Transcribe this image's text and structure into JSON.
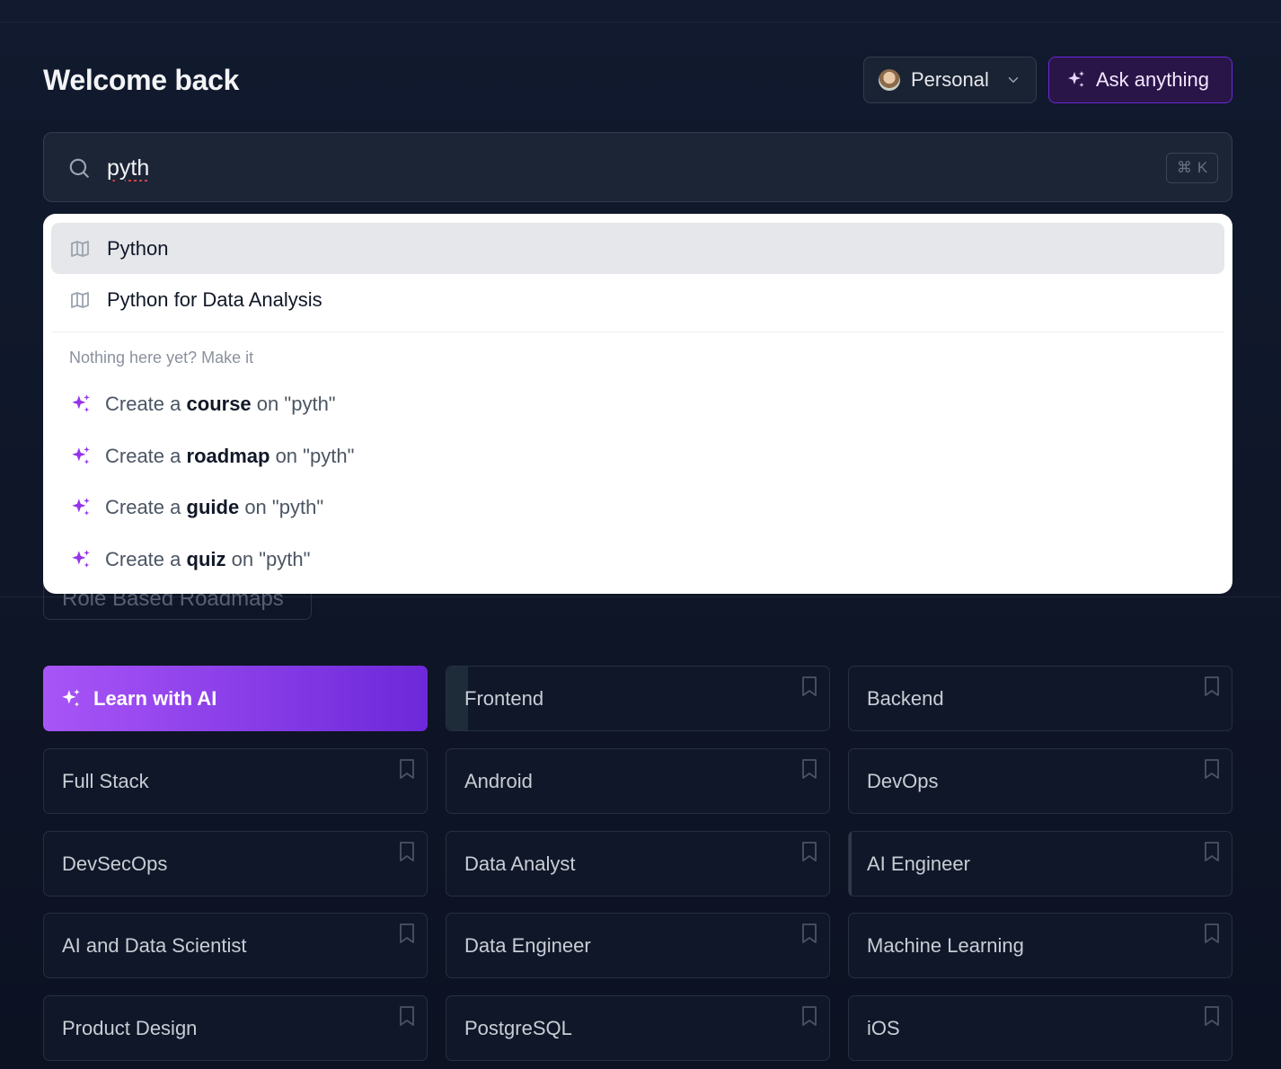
{
  "header": {
    "title": "Welcome back",
    "account_label": "Personal",
    "ask_label": "Ask anything"
  },
  "search": {
    "value": "pyth",
    "shortcut_symbol": "⌘",
    "shortcut_key": "K"
  },
  "dropdown": {
    "results": [
      {
        "label": "Python",
        "icon": "map-icon",
        "active": true
      },
      {
        "label": "Python for Data Analysis",
        "icon": "map-icon",
        "active": false
      }
    ],
    "section_label": "Nothing here yet? Make it",
    "create_prefix": "Create a",
    "create_infix": "on",
    "create_query": "\"pyth\"",
    "create_types": [
      "course",
      "roadmap",
      "guide",
      "quiz"
    ]
  },
  "hidden_tab_label": "Role Based Roadmaps",
  "learn_with_ai_label": "Learn with AI",
  "roadmaps": [
    {
      "label": "Frontend",
      "progress": 0.05
    },
    {
      "label": "Backend"
    },
    {
      "label": "Full Stack"
    },
    {
      "label": "Android"
    },
    {
      "label": "DevOps"
    },
    {
      "label": "DevSecOps"
    },
    {
      "label": "Data Analyst"
    },
    {
      "label": "AI Engineer",
      "progress": 0.01
    },
    {
      "label": "AI and Data Scientist"
    },
    {
      "label": "Data Engineer"
    },
    {
      "label": "Machine Learning"
    },
    {
      "label": "Product Design"
    },
    {
      "label": "PostgreSQL"
    },
    {
      "label": "iOS"
    }
  ],
  "colors": {
    "accent": "#9333ea",
    "background": "#0f1729",
    "dropdown_bg": "#ffffff"
  }
}
